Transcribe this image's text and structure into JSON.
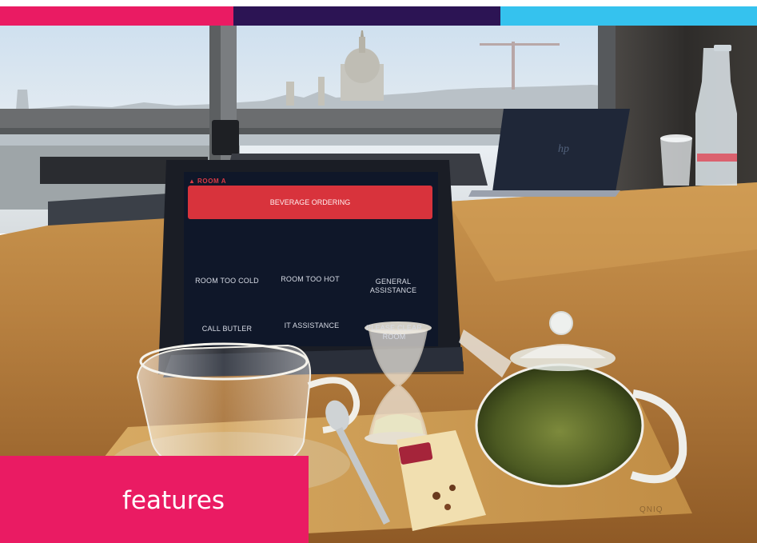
{
  "colors": {
    "bar_pink": "#ea1b63",
    "bar_purple": "#2c1454",
    "bar_cyan": "#35c2ee",
    "badge_bg": "#ea1b63",
    "badge_text": "#ffffff",
    "tablet_accent": "#d8333c"
  },
  "badge": {
    "label": "features"
  },
  "tablet": {
    "room": "ROOM A",
    "room_icon": "triangle-icon",
    "primary_button": "BEVERAGE ORDERING",
    "buttons": [
      {
        "label": "ROOM TOO COLD"
      },
      {
        "label": "ROOM TOO HOT"
      },
      {
        "label": "GENERAL\nASSISTANCE"
      },
      {
        "label": "CALL BUTLER"
      },
      {
        "label": "IT ASSISTANCE"
      },
      {
        "label": "PLEASE CLEAR\nROOM"
      }
    ]
  },
  "photo": {
    "laptop_logo": "hp",
    "tray_mark": "QNIQ"
  }
}
